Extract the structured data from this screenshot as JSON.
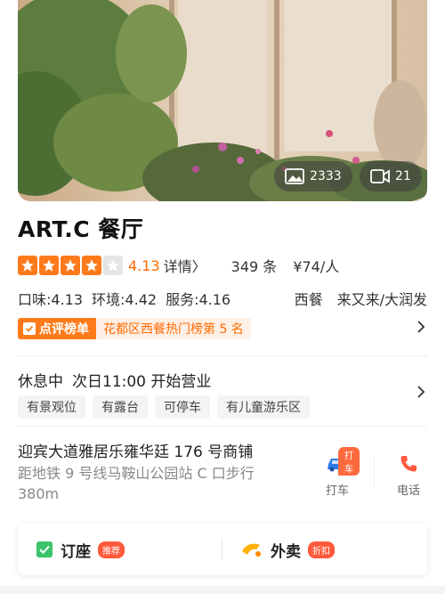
{
  "hero": {
    "photos_count": "2333",
    "videos_count": "21"
  },
  "shop": {
    "name": "ART.C 餐厅",
    "rating_stars": 4.13,
    "score": "4.13",
    "detail_link": "详情〉",
    "reviews": "349 条",
    "price": "¥74/人",
    "taste": "口味:4.13",
    "environment": "环境:4.42",
    "service": "服务:4.16",
    "category": "西餐",
    "area": "来又来/大润发",
    "rank_badge": "点评榜单",
    "rank_text": "花都区西餐热门榜第 5 名"
  },
  "hours": {
    "status": "休息中",
    "next": "次日11:00 开始营业",
    "tags": [
      "有景观位",
      "有露台",
      "可停车",
      "有儿童游乐区"
    ]
  },
  "address": {
    "line": "迎宾大道雅居乐雍华廷 176 号商铺",
    "distance": "距地铁 9 号线马鞍山公园站 C 口步行 380m"
  },
  "actions": {
    "taxi_label": "打车",
    "taxi_tag": "打车",
    "phone_label": "电话"
  },
  "bottom": {
    "book_label": "订座",
    "book_pill": "推荐",
    "takeout_label": "外卖",
    "takeout_pill": "折扣"
  },
  "colors": {
    "accent": "#ff7a1a",
    "score": "#ff6a00",
    "pill": "#ff5a3c",
    "book_green": "#3cc46b"
  }
}
